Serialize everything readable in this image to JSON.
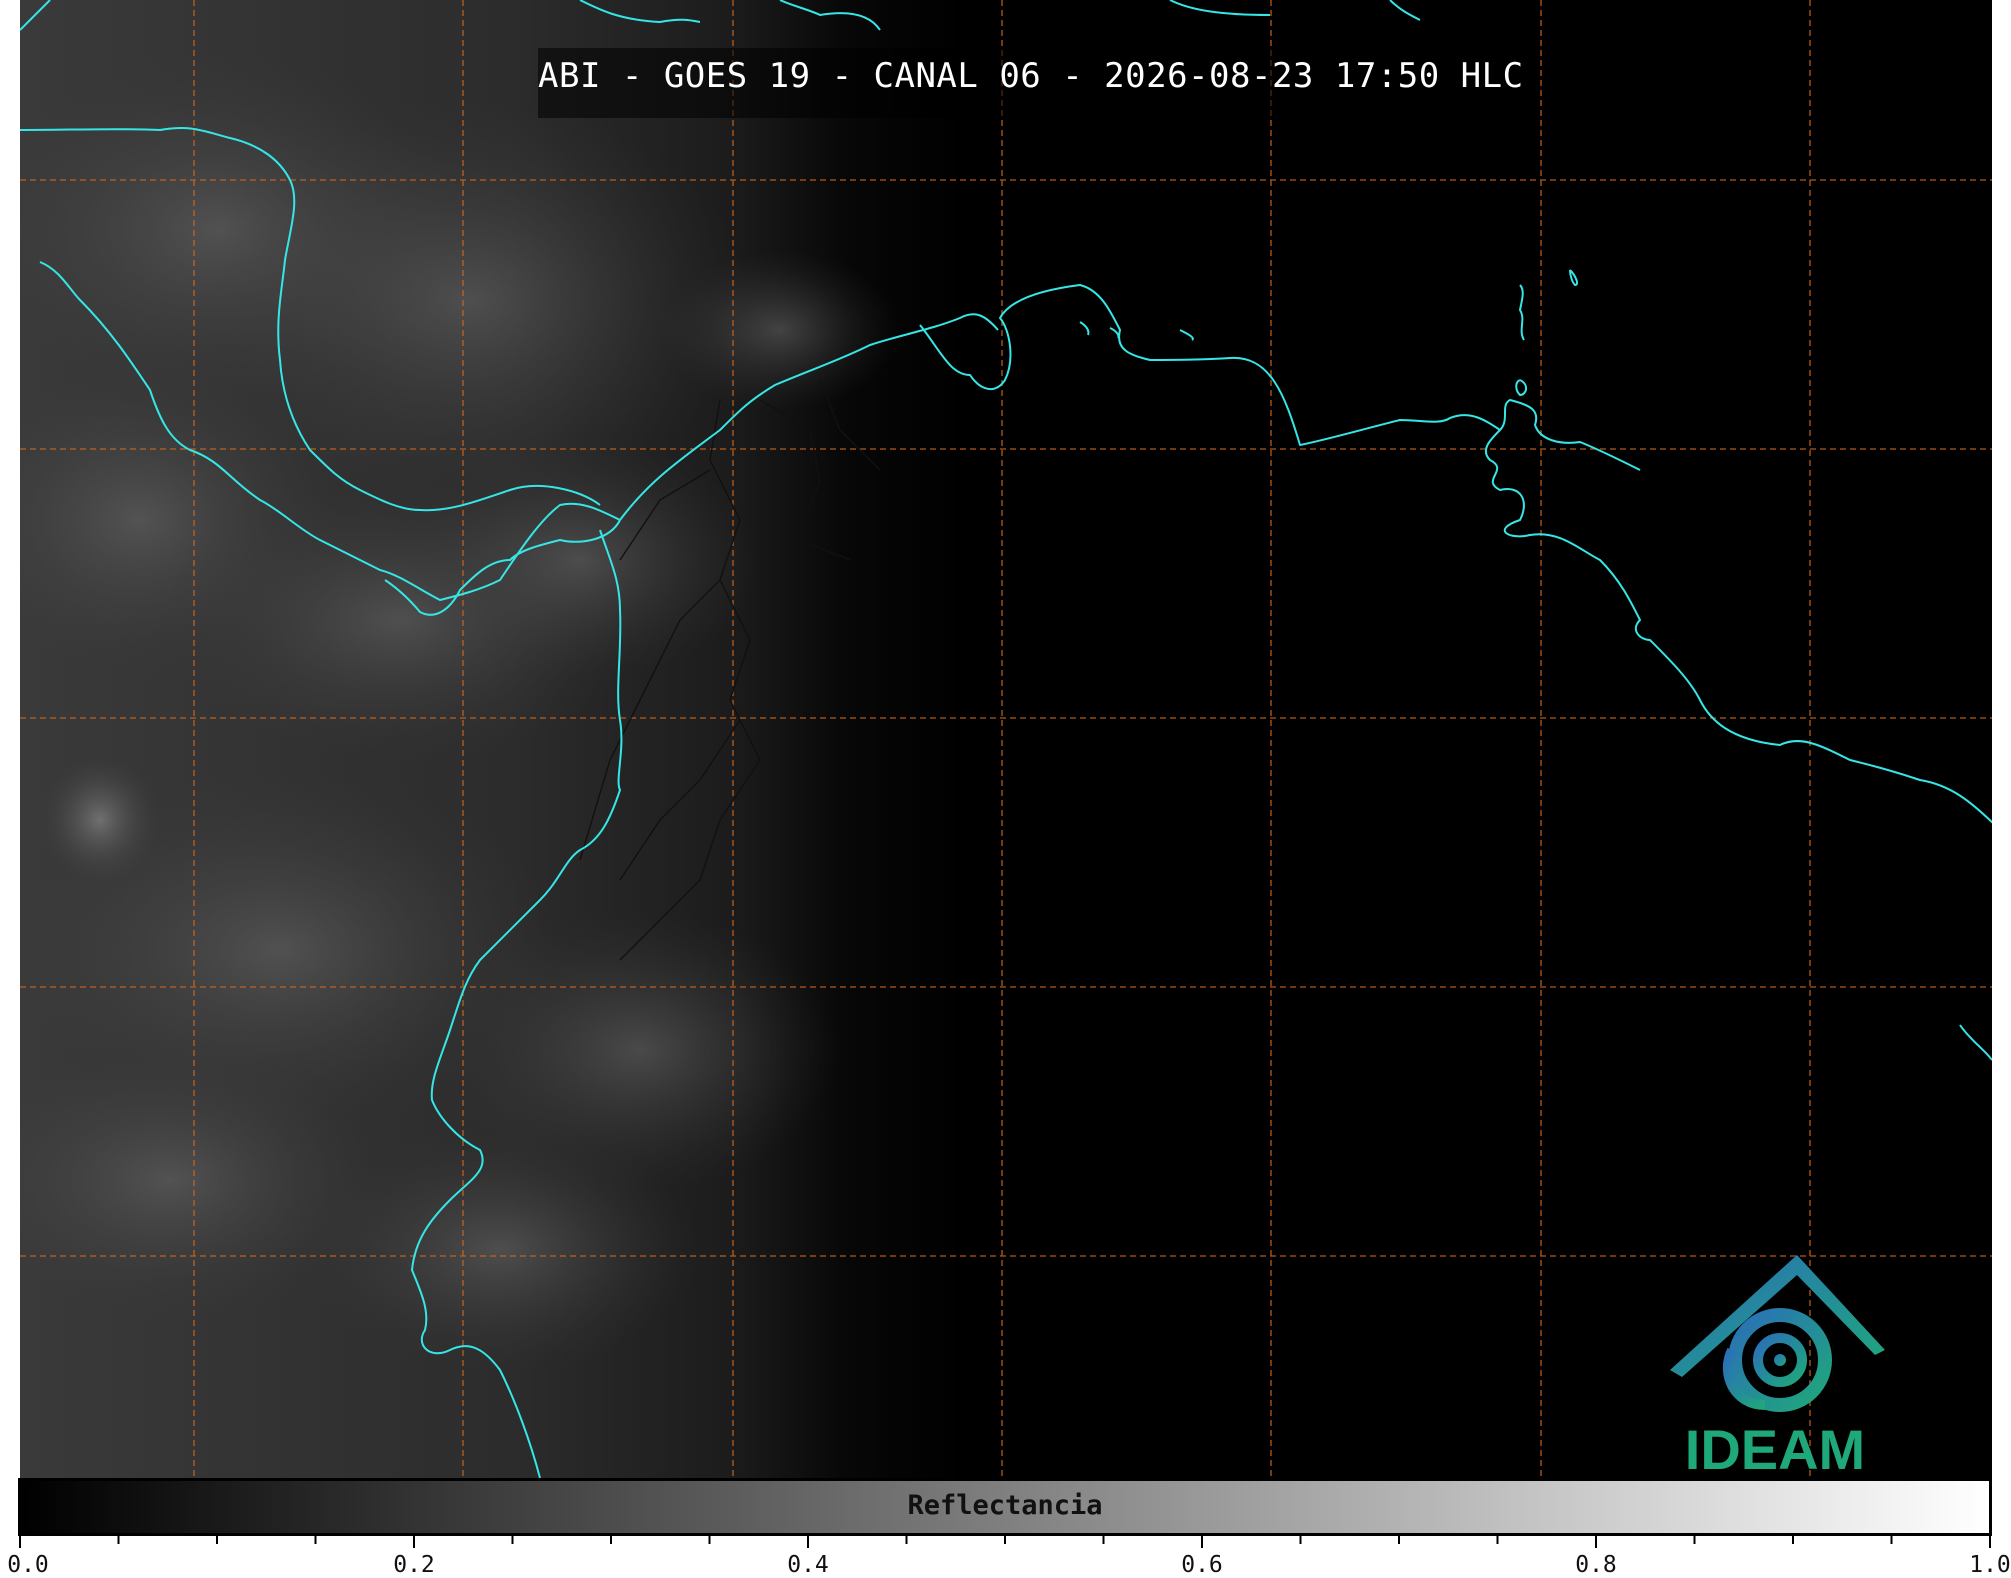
{
  "title": "ABI - GOES 19 - CANAL 06 - 2026-08-23 17:50 HLC",
  "map": {
    "coastline_color": "#36e6e6",
    "border_color": "#111111",
    "gridline_color": "#d2691e",
    "background_color": "#000000"
  },
  "logo": {
    "text": "IDEAM",
    "icon": "ideam-logo-icon",
    "colors": [
      "#2a6fb8",
      "#1fa87a"
    ]
  },
  "colorbar": {
    "label": "Reflectancia",
    "range": [
      0.0,
      1.0
    ],
    "colors": [
      "#000000",
      "#ffffff"
    ],
    "tick_labels": [
      "0.0",
      "0.2",
      "0.4",
      "0.6",
      "0.8",
      "1.0"
    ]
  }
}
